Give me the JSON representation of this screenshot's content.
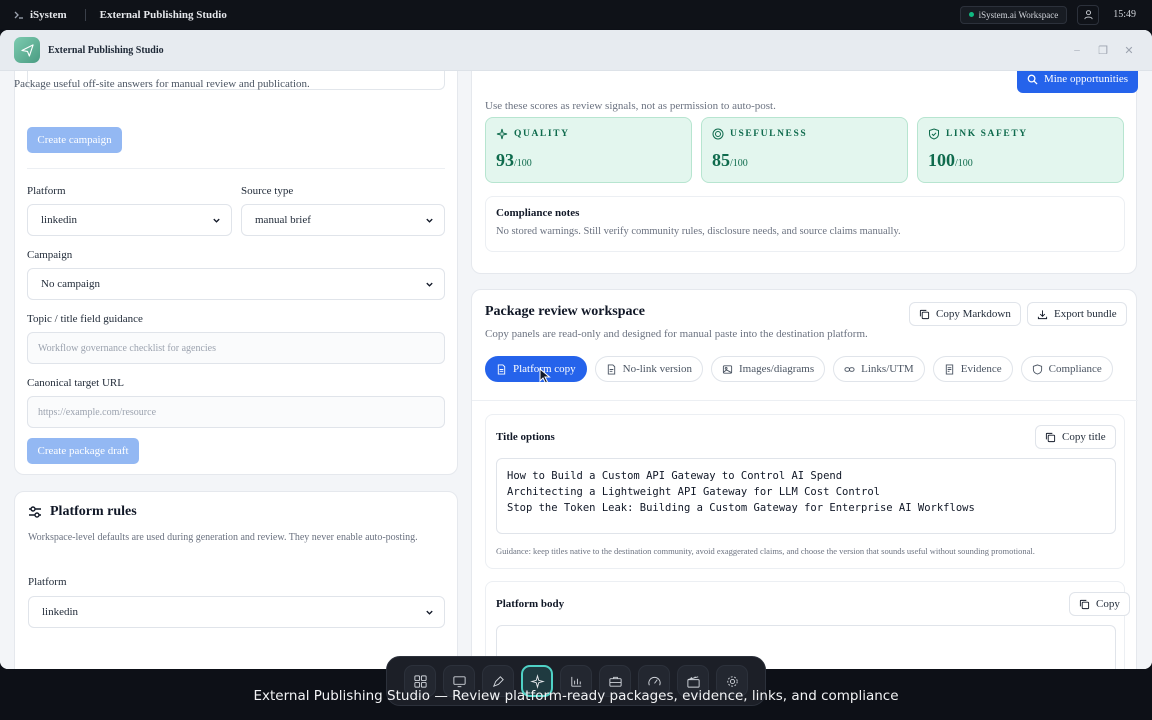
{
  "system_bar": {
    "brand": "iSystem",
    "app_title": "External Publishing Studio",
    "workspace": "iSystem.ai Workspace",
    "time": "15:49"
  },
  "window": {
    "title": "External Publishing Studio"
  },
  "left": {
    "intro": "Package useful off-site answers for manual review and publication.",
    "create_campaign_label": "Create campaign",
    "platform_label": "Platform",
    "platform_value": "linkedin",
    "source_type_label": "Source type",
    "source_type_value": "manual brief",
    "campaign_label": "Campaign",
    "campaign_value": "No campaign",
    "topic_label": "Topic / title field guidance",
    "topic_placeholder": "Workflow governance checklist for agencies",
    "canonical_label": "Canonical target URL",
    "canonical_placeholder": "https://example.com/resource",
    "create_draft_label": "Create package draft",
    "rules": {
      "title": "Platform rules",
      "description": "Workspace-level defaults are used during generation and review. They never enable auto-posting.",
      "platform_label": "Platform",
      "platform_value": "linkedin"
    }
  },
  "right": {
    "mine_button": "Mine opportunities",
    "scores_note": "Use these scores as review signals, not as permission to auto-post.",
    "scores": [
      {
        "label": "QUALITY",
        "value": "93",
        "suffix": "/100",
        "icon": "sparkle-icon"
      },
      {
        "label": "USEFULNESS",
        "value": "85",
        "suffix": "/100",
        "icon": "target-icon"
      },
      {
        "label": "LINK SAFETY",
        "value": "100",
        "suffix": "/100",
        "icon": "shield-check-icon"
      }
    ],
    "compliance_title": "Compliance notes",
    "compliance_text": "No stored warnings. Still verify community rules, disclosure needs, and source claims manually.",
    "workspace": {
      "title": "Package review workspace",
      "subtitle": "Copy panels are read-only and designed for manual paste into the destination platform.",
      "copy_markdown": "Copy Markdown",
      "export_bundle": "Export bundle",
      "tabs": [
        {
          "label": "Platform copy",
          "active": true
        },
        {
          "label": "No-link version",
          "active": false
        },
        {
          "label": "Images/diagrams",
          "active": false
        },
        {
          "label": "Links/UTM",
          "active": false
        },
        {
          "label": "Evidence",
          "active": false
        },
        {
          "label": "Compliance",
          "active": false
        }
      ],
      "title_options_label": "Title options",
      "copy_title": "Copy title",
      "title_options": "How to Build a Custom API Gateway to Control AI Spend\nArchitecting a Lightweight API Gateway for LLM Cost Control\nStop the Token Leak: Building a Custom Gateway for Enterprise AI Workflows",
      "guidance": "Guidance: keep titles native to the destination community, avoid exaggerated claims, and choose the version that sounds useful without sounding promotional.",
      "platform_body_label": "Platform body",
      "copy_label": "Copy"
    }
  },
  "caption": "External Publishing Studio — Review platform-ready packages, evidence, links, and compliance",
  "colors": {
    "accent": "#2563eb",
    "score_bg": "#e3f6ee",
    "score_text": "#0f6b4d"
  }
}
